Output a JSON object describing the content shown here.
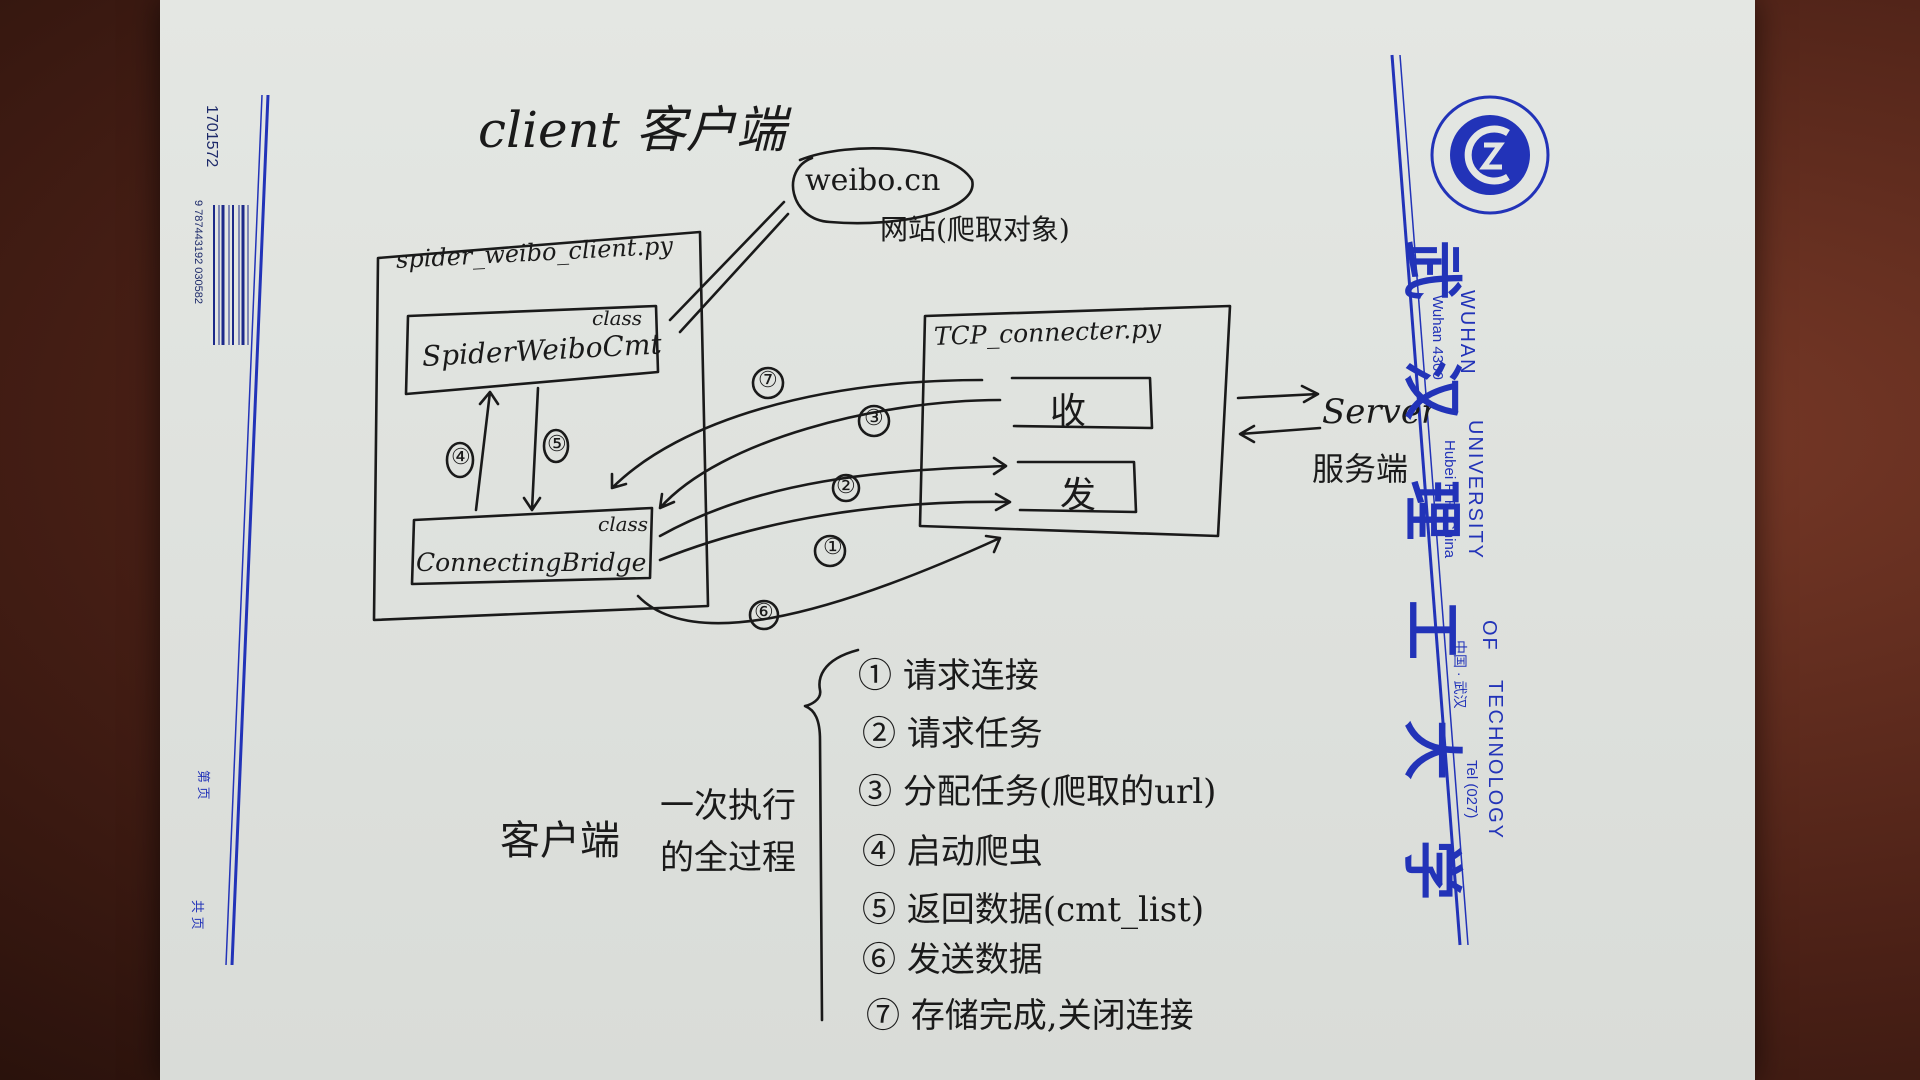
{
  "title": "client 客户端",
  "weibo": {
    "name": "weibo.cn",
    "desc": "网站(爬取对象)"
  },
  "client_file": {
    "name": "spider_weibo_client.py"
  },
  "spider_class": {
    "tag": "class",
    "name": "SpiderWeiboCmt"
  },
  "bridge_class": {
    "tag": "class",
    "name": "ConnectingBridge"
  },
  "tcp_file": {
    "name": "TCP_connecter.py",
    "recv": "收",
    "send": "发"
  },
  "server": {
    "name": "Server",
    "desc": "服务端"
  },
  "step_marks": [
    "①",
    "②",
    "③",
    "④",
    "⑤",
    "⑥",
    "⑦"
  ],
  "summary": {
    "left": "客户端",
    "right_line1": "一次执行",
    "right_line2": "的全过程"
  },
  "steps": [
    {
      "num": "①",
      "text": "请求连接"
    },
    {
      "num": "②",
      "text": "请求任务"
    },
    {
      "num": "③",
      "text": "分配任务(爬取的url)"
    },
    {
      "num": "④",
      "text": "启动爬虫"
    },
    {
      "num": "⑤",
      "text": "返回数据(cmt_list)"
    },
    {
      "num": "⑥",
      "text": "发送数据"
    },
    {
      "num": "⑦",
      "text": "存储完成,关闭连接"
    }
  ],
  "left_strip": {
    "serial": "1701572",
    "barcode_digits": "9 787443192 030582",
    "page_label": "第 页",
    "total_label": "共 页"
  },
  "university": {
    "cn": [
      "武",
      "汉",
      "理",
      "工",
      "大",
      "学"
    ],
    "en1": "WUHAN",
    "en2": "UNIVERSITY",
    "en3": "OF",
    "en4": "TECHNOLOGY",
    "addr1": "Wuhan 4300",
    "addr2": "Hubei  P. R. China",
    "addr3": "中国 · 武汉",
    "tel": "Tel (027)",
    "seal_text": "WUHAN UNIVERSITY OF TECHNOLOGY"
  },
  "colors": {
    "ink": "#1a1a1a",
    "brand": "#2233b8",
    "paper": "#dfe2de",
    "desk": "#5a2a1e"
  }
}
